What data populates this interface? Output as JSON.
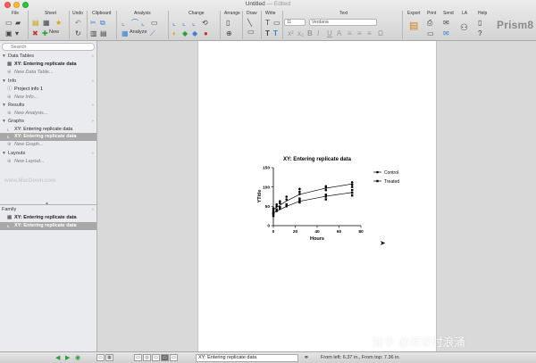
{
  "window": {
    "title": "Untitled",
    "status": "— Edited"
  },
  "toolbar": {
    "groups": [
      "File",
      "Sheet",
      "Undo",
      "Clipboard",
      "Analysis",
      "Change",
      "Arrange",
      "Draw",
      "Write",
      "Text",
      "Export",
      "Print",
      "Send",
      "LA",
      "Help"
    ],
    "analyze_label": "Analyze",
    "new_label": "New",
    "font_size": "11",
    "font_name": "Verdana",
    "app_logo": "Prism8"
  },
  "sidebar": {
    "search_placeholder": "Search",
    "sections": [
      {
        "title": "Data Tables",
        "items": [
          {
            "label": "XY: Entering replicate data",
            "icon": "table-icon",
            "bold": true
          },
          {
            "label": "New Data Table...",
            "icon": "plus-icon",
            "new": true
          }
        ]
      },
      {
        "title": "Info",
        "items": [
          {
            "label": "Project info 1",
            "icon": "info-icon"
          },
          {
            "label": "New Info...",
            "icon": "plus-icon",
            "new": true
          }
        ]
      },
      {
        "title": "Results",
        "items": [
          {
            "label": "New Analysis...",
            "icon": "plus-icon",
            "new": true
          }
        ]
      },
      {
        "title": "Graphs",
        "items": [
          {
            "label": "XY: Entering replicate data",
            "icon": "graph-icon"
          },
          {
            "label": "XY: Entering replicate data",
            "icon": "graph-icon",
            "selected": true
          },
          {
            "label": "New Graph...",
            "icon": "plus-icon",
            "new": true
          }
        ]
      },
      {
        "title": "Layouts",
        "items": [
          {
            "label": "New Layout...",
            "icon": "plus-icon",
            "new": true
          }
        ]
      }
    ],
    "watermark": "www.MacDown.com",
    "family": {
      "title": "Family",
      "items": [
        {
          "label": "XY: Entering replicate data",
          "icon": "table-icon",
          "bold": true
        },
        {
          "label": "XY: Entering replicate data",
          "icon": "graph-icon",
          "selected": true
        }
      ]
    }
  },
  "chart_data": {
    "type": "scatter",
    "title": "XY: Entering replicate data",
    "xlabel": "Hours",
    "ylabel": "YTitle",
    "xlim": [
      0,
      80
    ],
    "ylim": [
      0,
      150
    ],
    "xticks": [
      0,
      20,
      40,
      60,
      80
    ],
    "yticks": [
      0,
      50,
      100,
      150
    ],
    "grid": false,
    "legend_position": "right",
    "series": [
      {
        "name": "Control",
        "marker": "filled-circle",
        "x": [
          0,
          0,
          0,
          3,
          3,
          6,
          6,
          12,
          12,
          24,
          24,
          24,
          48,
          48,
          48,
          72,
          72,
          72
        ],
        "y": [
          35,
          40,
          45,
          50,
          55,
          58,
          63,
          68,
          75,
          82,
          88,
          95,
          92,
          98,
          102,
          100,
          106,
          112
        ],
        "fit_x": [
          0,
          12,
          24,
          48,
          72
        ],
        "fit_y": [
          42,
          64,
          81,
          97,
          108
        ]
      },
      {
        "name": "Treated",
        "marker": "filled-square",
        "x": [
          0,
          0,
          0,
          3,
          3,
          6,
          6,
          12,
          12,
          24,
          24,
          24,
          48,
          48,
          48,
          72,
          72,
          72
        ],
        "y": [
          25,
          30,
          32,
          38,
          42,
          44,
          48,
          50,
          55,
          60,
          65,
          70,
          68,
          75,
          80,
          78,
          85,
          92
        ],
        "fit_x": [
          0,
          12,
          24,
          48,
          72
        ],
        "fit_y": [
          33,
          50,
          63,
          76,
          86
        ]
      }
    ]
  },
  "status": {
    "sheet_name": "XY: Entering replicate data",
    "position": "From left: 6.37 in., From top: 7.36 in."
  },
  "overlay": {
    "watermark": "知乎 @海深时浪涌"
  }
}
